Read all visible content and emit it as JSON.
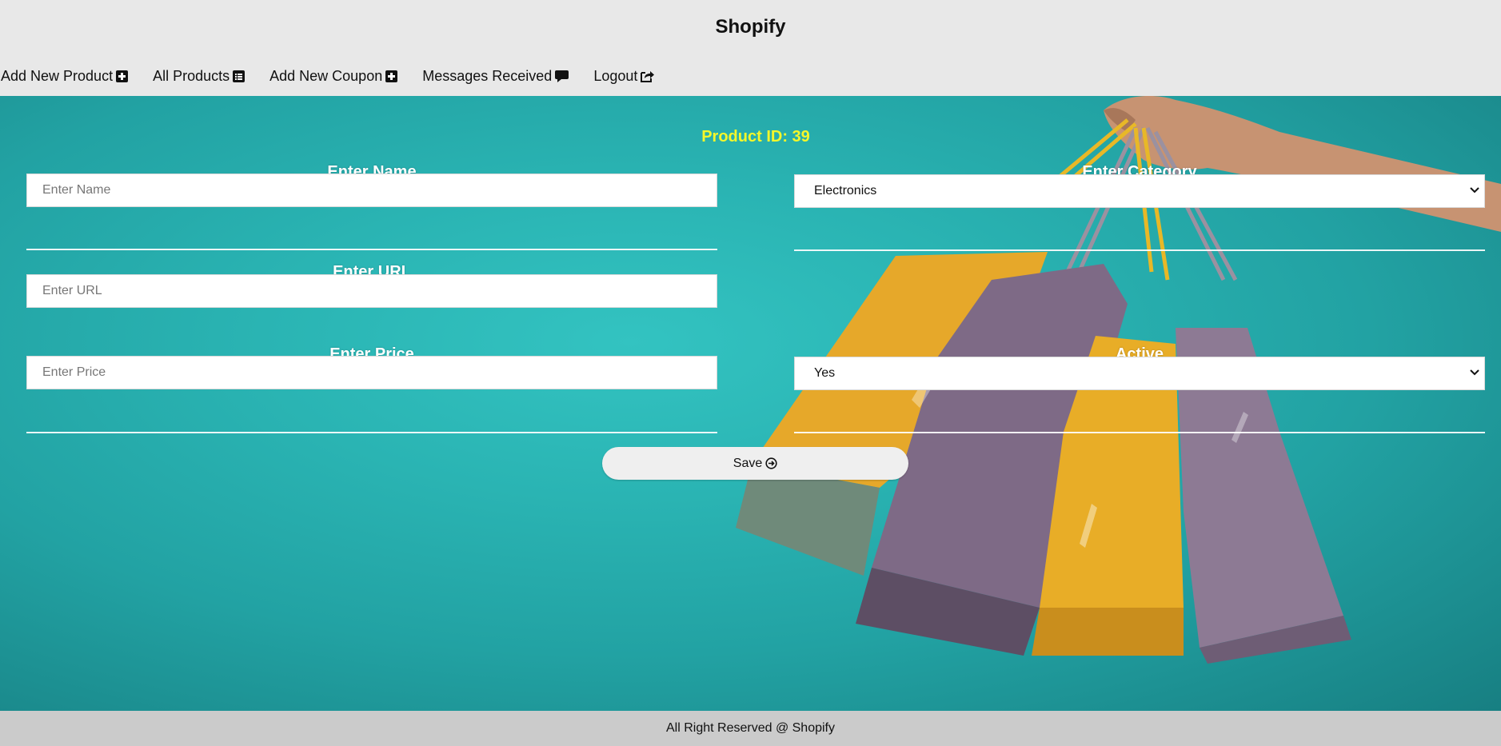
{
  "app": {
    "title": "Shopify"
  },
  "nav": {
    "items": [
      {
        "label": "Add New Product",
        "icon": "plus-square-icon"
      },
      {
        "label": "All Products",
        "icon": "list-alt-icon"
      },
      {
        "label": "Add New Coupon",
        "icon": "plus-square-icon"
      },
      {
        "label": "Messages Received",
        "icon": "comment-icon"
      },
      {
        "label": "Logout",
        "icon": "share-square-icon"
      }
    ]
  },
  "form": {
    "product_id": "Product ID: 39",
    "name": {
      "label": "Enter Name",
      "placeholder": "Enter Name",
      "value": ""
    },
    "category": {
      "label": "Enter Category",
      "selected": "Electronics"
    },
    "url": {
      "label": "Enter URL",
      "placeholder": "Enter URL",
      "value": ""
    },
    "price": {
      "label": "Enter Price",
      "placeholder": "Enter Price",
      "value": ""
    },
    "active": {
      "label": "Active",
      "selected": "Yes"
    },
    "save": {
      "label": "Save",
      "icon": "arrow-circle-right-icon"
    }
  },
  "footer": {
    "text": "All Right Reserved @ Shopify"
  },
  "colors": {
    "accent_yellow": "#f4f72a",
    "hero_teal": "#2ab4b3",
    "header_bg": "#e8e8e8",
    "footer_bg": "#cbcbcb"
  }
}
